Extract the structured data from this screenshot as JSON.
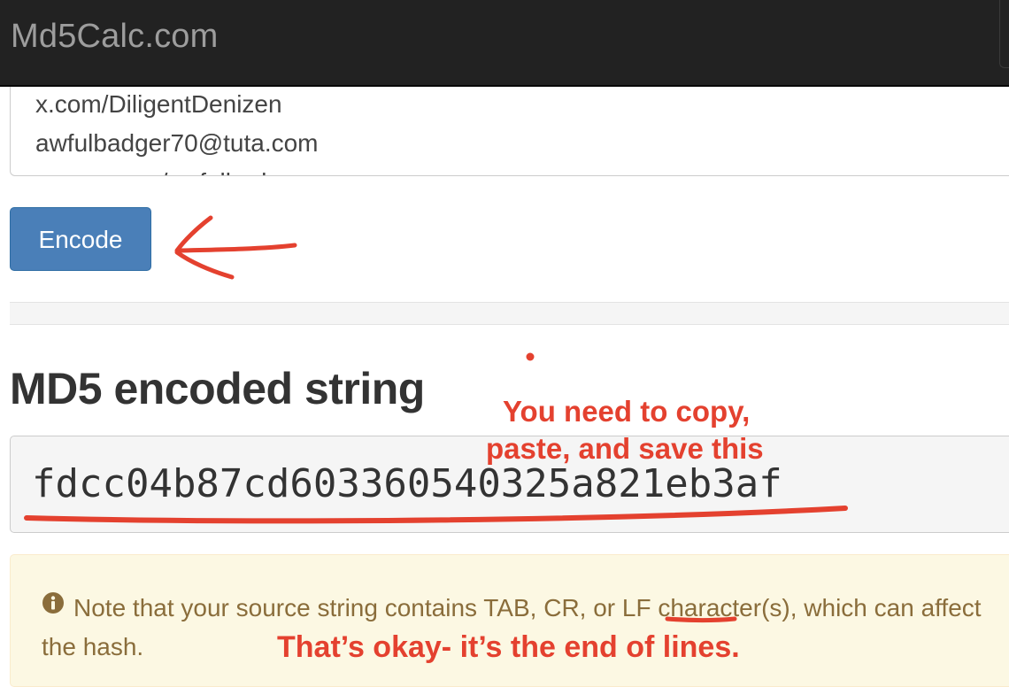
{
  "navbar": {
    "brand": "Md5Calc.com"
  },
  "source": {
    "lines": [
      "x.com/DiligentDenizen",
      "awfulbadger70@tuta.com",
      "www.x.com/awfulbadger"
    ]
  },
  "encode_button": {
    "label": "Encode"
  },
  "result": {
    "heading": "MD5 encoded string",
    "hash": "fdcc04b87cd603360540325a821eb3af"
  },
  "note": {
    "icon": "info-circle-icon",
    "text": "Note that your source string contains TAB, CR, or LF character(s), which can affect the hash."
  },
  "annotations": {
    "copy_note_line1": "You need to copy,",
    "copy_note_line2": "paste, and save this",
    "lines_note": "That’s okay- it’s the end of lines."
  },
  "colors": {
    "navbar": "#222222",
    "brand": "#9d9d9d",
    "button": "#4a7fb8",
    "note_bg": "#fcf8e3",
    "note_text": "#8a6d3b",
    "annotation": "#e4412f"
  }
}
